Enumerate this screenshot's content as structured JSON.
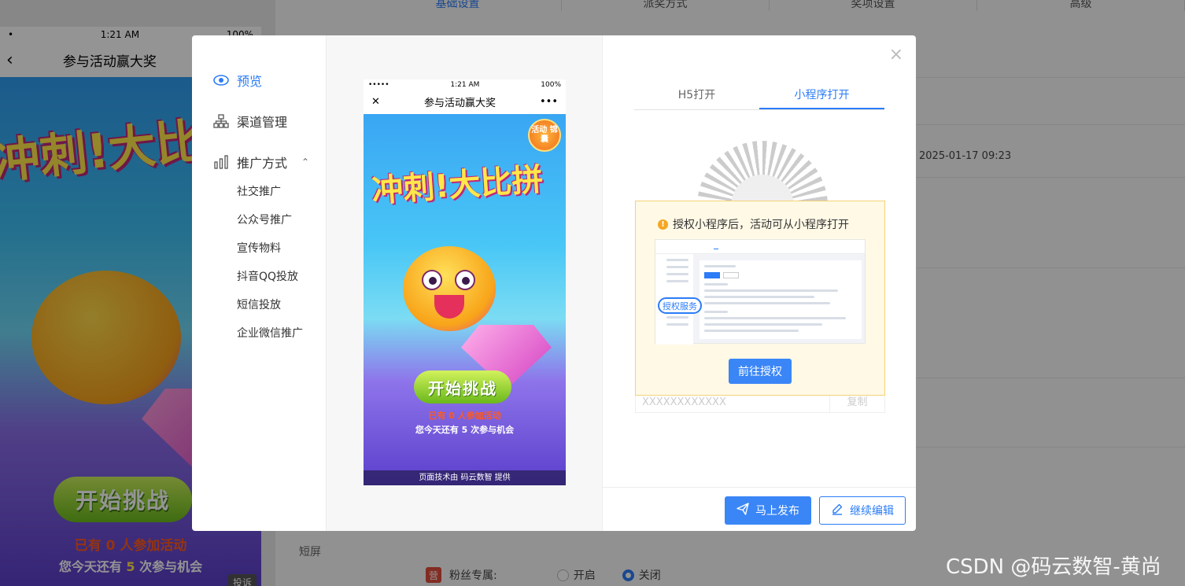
{
  "background": {
    "phone": {
      "time": "1:21 AM",
      "battery": "100%",
      "back": "‹",
      "title": "参与活动赢大奖",
      "game_title": "冲刺!大比",
      "start_button": "开始挑战",
      "line1_pre": "已有",
      "line1_count": "0",
      "line1_post": "人参加活动",
      "line2_pre": "您今天还有",
      "line2_count": "5",
      "line2_post": "次参与机会",
      "report": "投诉"
    },
    "tabs": [
      "基础设置",
      "派奖方式",
      "奖项设置",
      "高级"
    ],
    "date": "2025-01-17 09:23",
    "short_screen": "短屏",
    "fans_badge": "营",
    "fans_label": "粉丝专属:",
    "fans_options": [
      "开启",
      "关闭"
    ],
    "fans_selected": "关闭",
    "watermark": "CSDN @码云数智-黄尚"
  },
  "modal": {
    "sidebar": {
      "preview": "预览",
      "channel": "渠道管理",
      "promo": "推广方式",
      "sub_items": [
        "社交推广",
        "公众号推广",
        "宣传物料",
        "抖音QQ投放",
        "短信投放",
        "企业微信推广"
      ]
    },
    "phone": {
      "signal": "•••••",
      "time": "1:21 AM",
      "battery": "100%",
      "close": "✕",
      "title": "参与活动赢大奖",
      "more": "•••",
      "badge": "活动 锦囊",
      "game_title": "冲刺!大比拼",
      "start_button": "开始挑战",
      "line1": "已有 0 人参加活动",
      "line2": "您今天还有 5 次参与机会",
      "footer": "页面技术由 码云数智 提供"
    },
    "tabs": [
      "H5打开",
      "小程序打开"
    ],
    "active_tab": "小程序打开",
    "auth_tip": "授权小程序后，活动可从小程序打开",
    "auth_pill": "授权服务",
    "auth_button": "前往授权",
    "copy_value": "XXXXXXXXXXXX",
    "copy_button": "复制",
    "publish_button": "马上发布",
    "edit_button": "继续编辑",
    "close": "×",
    "accent": "#2b7cf6"
  }
}
